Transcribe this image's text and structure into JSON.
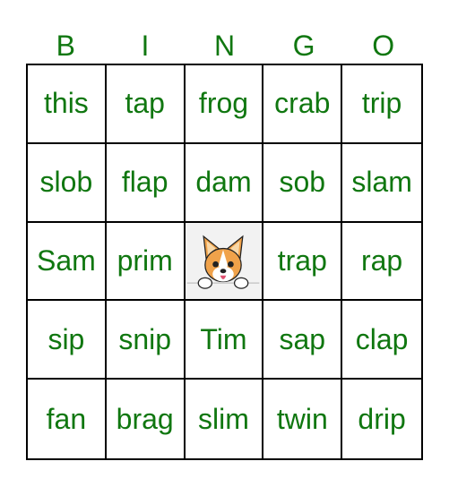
{
  "header": [
    "B",
    "I",
    "N",
    "G",
    "O"
  ],
  "rows": [
    [
      "this",
      "tap",
      "frog",
      "crab",
      "trip"
    ],
    [
      "slob",
      "flap",
      "dam",
      "sob",
      "slam"
    ],
    [
      "Sam",
      "prim",
      "",
      "trap",
      "rap"
    ],
    [
      "sip",
      "snip",
      "Tim",
      "sap",
      "clap"
    ],
    [
      "fan",
      "brag",
      "slim",
      "twin",
      "drip"
    ]
  ],
  "free_space": {
    "icon": "corgi-dog-icon"
  },
  "colors": {
    "text": "#107710",
    "border": "#000000"
  }
}
